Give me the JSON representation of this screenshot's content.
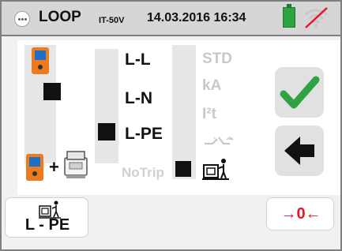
{
  "header": {
    "title": "LOOP",
    "subtitle": "IT-50V",
    "datetime": "14.03.2016 16:34",
    "menu_icon": "menu-dots-icon",
    "battery_icon": "battery-full-icon",
    "wireless_icon": "wireless-disabled-icon"
  },
  "types": {
    "items": [
      "L-L",
      "L-N",
      "L-PE"
    ],
    "selected": "L-PE",
    "notrip": "NoTrip"
  },
  "modes": {
    "labels": [
      "STD",
      "kA",
      "I²t"
    ],
    "rcd_icon": "rcd-trip-icon",
    "earth_icon": "earth-person-icon",
    "selected": "earth-person-icon"
  },
  "actions": {
    "confirm_icon": "checkmark-icon",
    "back_icon": "back-arrow-icon",
    "lpe_label": "L - PE",
    "zero_label": "→0←"
  },
  "colors": {
    "confirm": "#2fa344",
    "zero": "#e8152b",
    "battery": "#2fa344",
    "wireless_strike": "#e8152b"
  }
}
